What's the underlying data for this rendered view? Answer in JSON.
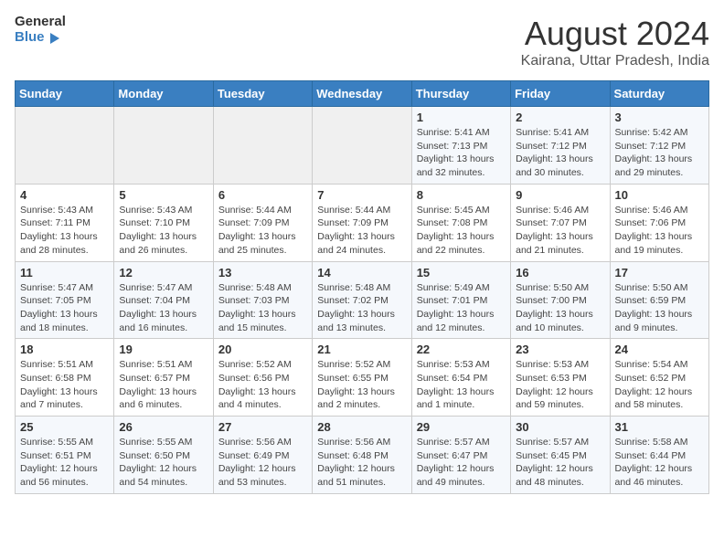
{
  "logo": {
    "line1": "General",
    "line2": "Blue"
  },
  "title": "August 2024",
  "subtitle": "Kairana, Uttar Pradesh, India",
  "days_of_week": [
    "Sunday",
    "Monday",
    "Tuesday",
    "Wednesday",
    "Thursday",
    "Friday",
    "Saturday"
  ],
  "weeks": [
    [
      {
        "day": "",
        "info": ""
      },
      {
        "day": "",
        "info": ""
      },
      {
        "day": "",
        "info": ""
      },
      {
        "day": "",
        "info": ""
      },
      {
        "day": "1",
        "info": "Sunrise: 5:41 AM\nSunset: 7:13 PM\nDaylight: 13 hours\nand 32 minutes."
      },
      {
        "day": "2",
        "info": "Sunrise: 5:41 AM\nSunset: 7:12 PM\nDaylight: 13 hours\nand 30 minutes."
      },
      {
        "day": "3",
        "info": "Sunrise: 5:42 AM\nSunset: 7:12 PM\nDaylight: 13 hours\nand 29 minutes."
      }
    ],
    [
      {
        "day": "4",
        "info": "Sunrise: 5:43 AM\nSunset: 7:11 PM\nDaylight: 13 hours\nand 28 minutes."
      },
      {
        "day": "5",
        "info": "Sunrise: 5:43 AM\nSunset: 7:10 PM\nDaylight: 13 hours\nand 26 minutes."
      },
      {
        "day": "6",
        "info": "Sunrise: 5:44 AM\nSunset: 7:09 PM\nDaylight: 13 hours\nand 25 minutes."
      },
      {
        "day": "7",
        "info": "Sunrise: 5:44 AM\nSunset: 7:09 PM\nDaylight: 13 hours\nand 24 minutes."
      },
      {
        "day": "8",
        "info": "Sunrise: 5:45 AM\nSunset: 7:08 PM\nDaylight: 13 hours\nand 22 minutes."
      },
      {
        "day": "9",
        "info": "Sunrise: 5:46 AM\nSunset: 7:07 PM\nDaylight: 13 hours\nand 21 minutes."
      },
      {
        "day": "10",
        "info": "Sunrise: 5:46 AM\nSunset: 7:06 PM\nDaylight: 13 hours\nand 19 minutes."
      }
    ],
    [
      {
        "day": "11",
        "info": "Sunrise: 5:47 AM\nSunset: 7:05 PM\nDaylight: 13 hours\nand 18 minutes."
      },
      {
        "day": "12",
        "info": "Sunrise: 5:47 AM\nSunset: 7:04 PM\nDaylight: 13 hours\nand 16 minutes."
      },
      {
        "day": "13",
        "info": "Sunrise: 5:48 AM\nSunset: 7:03 PM\nDaylight: 13 hours\nand 15 minutes."
      },
      {
        "day": "14",
        "info": "Sunrise: 5:48 AM\nSunset: 7:02 PM\nDaylight: 13 hours\nand 13 minutes."
      },
      {
        "day": "15",
        "info": "Sunrise: 5:49 AM\nSunset: 7:01 PM\nDaylight: 13 hours\nand 12 minutes."
      },
      {
        "day": "16",
        "info": "Sunrise: 5:50 AM\nSunset: 7:00 PM\nDaylight: 13 hours\nand 10 minutes."
      },
      {
        "day": "17",
        "info": "Sunrise: 5:50 AM\nSunset: 6:59 PM\nDaylight: 13 hours\nand 9 minutes."
      }
    ],
    [
      {
        "day": "18",
        "info": "Sunrise: 5:51 AM\nSunset: 6:58 PM\nDaylight: 13 hours\nand 7 minutes."
      },
      {
        "day": "19",
        "info": "Sunrise: 5:51 AM\nSunset: 6:57 PM\nDaylight: 13 hours\nand 6 minutes."
      },
      {
        "day": "20",
        "info": "Sunrise: 5:52 AM\nSunset: 6:56 PM\nDaylight: 13 hours\nand 4 minutes."
      },
      {
        "day": "21",
        "info": "Sunrise: 5:52 AM\nSunset: 6:55 PM\nDaylight: 13 hours\nand 2 minutes."
      },
      {
        "day": "22",
        "info": "Sunrise: 5:53 AM\nSunset: 6:54 PM\nDaylight: 13 hours\nand 1 minute."
      },
      {
        "day": "23",
        "info": "Sunrise: 5:53 AM\nSunset: 6:53 PM\nDaylight: 12 hours\nand 59 minutes."
      },
      {
        "day": "24",
        "info": "Sunrise: 5:54 AM\nSunset: 6:52 PM\nDaylight: 12 hours\nand 58 minutes."
      }
    ],
    [
      {
        "day": "25",
        "info": "Sunrise: 5:55 AM\nSunset: 6:51 PM\nDaylight: 12 hours\nand 56 minutes."
      },
      {
        "day": "26",
        "info": "Sunrise: 5:55 AM\nSunset: 6:50 PM\nDaylight: 12 hours\nand 54 minutes."
      },
      {
        "day": "27",
        "info": "Sunrise: 5:56 AM\nSunset: 6:49 PM\nDaylight: 12 hours\nand 53 minutes."
      },
      {
        "day": "28",
        "info": "Sunrise: 5:56 AM\nSunset: 6:48 PM\nDaylight: 12 hours\nand 51 minutes."
      },
      {
        "day": "29",
        "info": "Sunrise: 5:57 AM\nSunset: 6:47 PM\nDaylight: 12 hours\nand 49 minutes."
      },
      {
        "day": "30",
        "info": "Sunrise: 5:57 AM\nSunset: 6:45 PM\nDaylight: 12 hours\nand 48 minutes."
      },
      {
        "day": "31",
        "info": "Sunrise: 5:58 AM\nSunset: 6:44 PM\nDaylight: 12 hours\nand 46 minutes."
      }
    ]
  ]
}
